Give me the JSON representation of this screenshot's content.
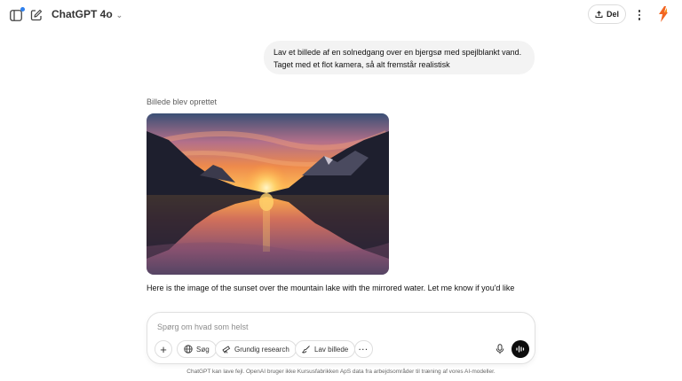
{
  "header": {
    "model_name": "ChatGPT 4o",
    "share_label": "Del",
    "icons": [
      "sidebar-icon",
      "new-chat-icon",
      "chevron-down-icon",
      "share-icon",
      "more-vertical-icon",
      "app-logo"
    ],
    "colors": {
      "notification_dot": "#2f80ed",
      "logo": "#f26522"
    }
  },
  "conversation": {
    "user_message": "Lav et billede af en solnedgang over en bjergsø med spejlblankt vand. Taget med et flot kamera, så alt fremstår realistisk",
    "image_status": "Billede blev oprettet",
    "generated_image": "sunset over mountain lake with mirrored reflection",
    "assistant_reply": "Here is the image of the sunset over the mountain lake with the mirrored water. Let me know if you'd like"
  },
  "composer": {
    "placeholder": "Spørg om hvad som helst",
    "value": "",
    "tools": [
      {
        "label": "Søg",
        "icon": "globe-icon"
      },
      {
        "label": "Grundig research",
        "icon": "telescope-icon"
      },
      {
        "label": "Lav billede",
        "icon": "image-brush-icon"
      }
    ],
    "more_label": "···"
  },
  "footer": {
    "disclaimer": "ChatGPT kan lave fejl. OpenAI bruger ikke Kursusfabrikken ApS data fra arbejdsområder til træning af vores AI-modeller."
  }
}
